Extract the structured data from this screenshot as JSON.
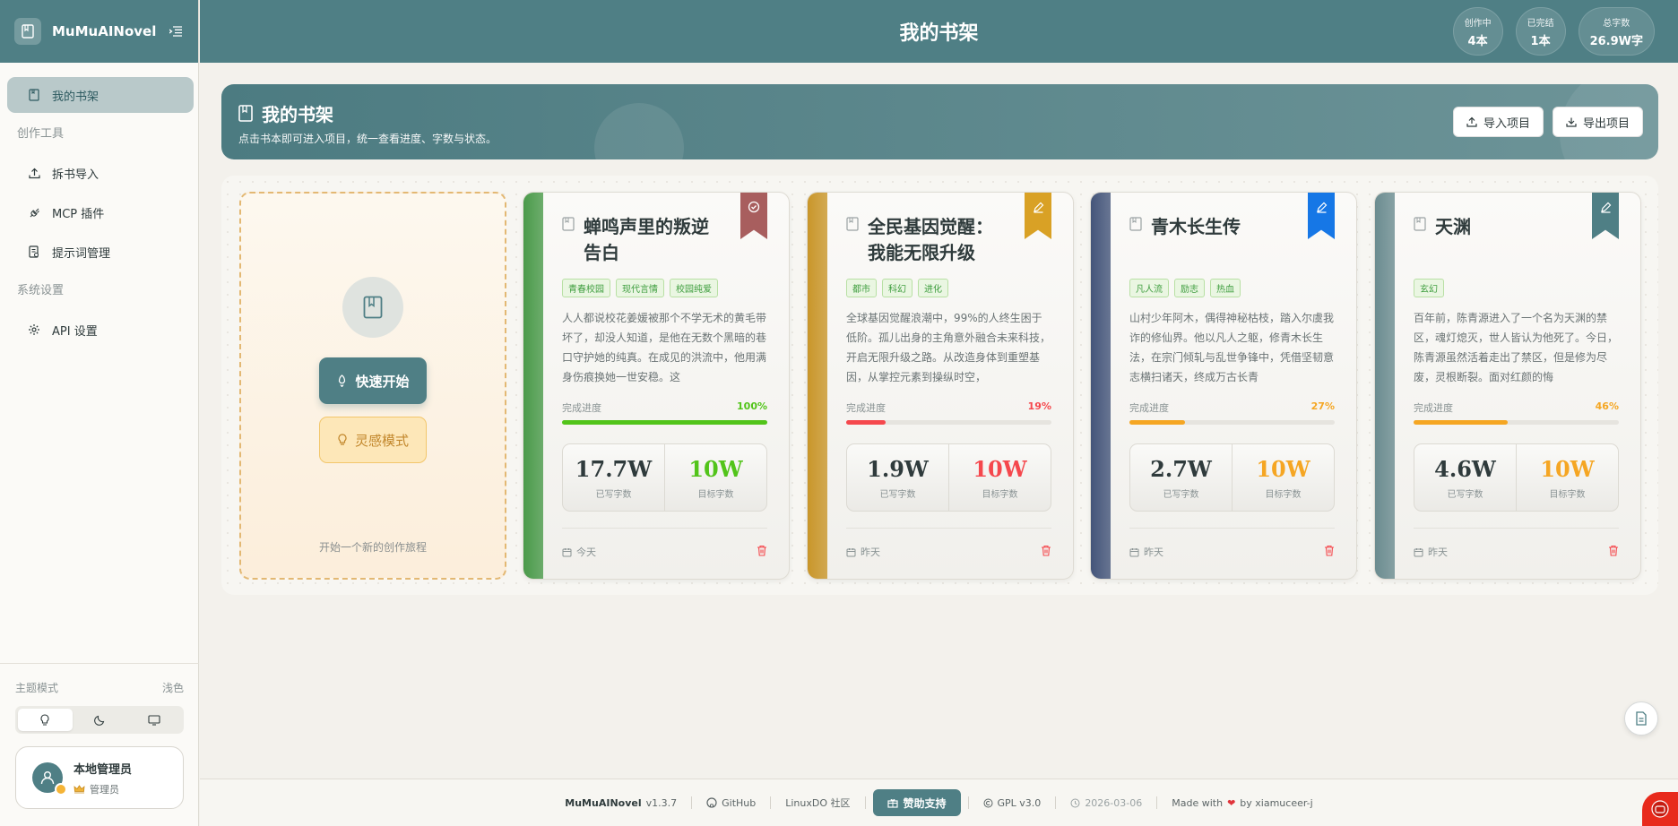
{
  "app": {
    "name": "MuMuAINovel"
  },
  "sidebar": {
    "items": [
      {
        "label": "我的书架",
        "icon": "book-icon"
      },
      {
        "label": "拆书导入",
        "icon": "upload-icon"
      },
      {
        "label": "MCP 插件",
        "icon": "plug-icon"
      },
      {
        "label": "提示词管理",
        "icon": "prompt-doc-icon"
      },
      {
        "label": "API 设置",
        "icon": "gear-icon"
      }
    ],
    "groups": {
      "tools": "创作工具",
      "system": "系统设置"
    },
    "theme": {
      "label": "主题模式",
      "current": "浅色"
    },
    "user": {
      "name": "本地管理员",
      "role": "管理员"
    }
  },
  "header": {
    "title": "我的书架",
    "stats": [
      {
        "label": "创作中",
        "value": "4本"
      },
      {
        "label": "已完结",
        "value": "1本"
      },
      {
        "label": "总字数",
        "value": "26.9W字"
      }
    ]
  },
  "hero": {
    "title": "我的书架",
    "subtitle": "点击书本即可进入项目，统一查看进度、字数与状态。",
    "import_label": "导入项目",
    "export_label": "导出项目"
  },
  "new_card": {
    "quick_label": "快速开始",
    "inspiration_label": "灵感模式",
    "hint": "开始一个新的创作旅程"
  },
  "labels": {
    "progress": "完成进度",
    "written": "已写字数",
    "target": "目标字数"
  },
  "books": [
    {
      "title": "蝉鸣声里的叛逆告白",
      "tags": [
        "青春校园",
        "现代言情",
        "校园纯爱"
      ],
      "description": "人人都说校花姜媛被那个不学无术的黄毛带坏了，却没人知道，是他在无数个黑暗的巷口守护她的纯真。在成见的洪流中，他用满身伤痕换她一世安稳。这",
      "progress_pct": 100,
      "progress_label": "100%",
      "progress_color": "#52c41a",
      "written": "17.7W",
      "target": "10W",
      "target_color": "#52c41a",
      "date": "今天",
      "spine": "#4a9a4a",
      "ribbon": "#a85e5e",
      "ribbon_icon": "check-circle-icon"
    },
    {
      "title": "全民基因觉醒：我能无限升级",
      "tags": [
        "都市",
        "科幻",
        "进化"
      ],
      "description": "全球基因觉醒浪潮中，99%的人终生困于低阶。孤儿出身的主角意外融合未来科技，开启无限升级之路。从改造身体到重塑基因，从掌控元素到操纵时空，",
      "progress_pct": 19,
      "progress_label": "19%",
      "progress_color": "#f5484d",
      "written": "1.9W",
      "target": "10W",
      "target_color": "#f5484d",
      "date": "昨天",
      "spine": "#c9962a",
      "ribbon": "#d9a125",
      "ribbon_icon": "pen-icon"
    },
    {
      "title": "青木长生传",
      "tags": [
        "凡人流",
        "励志",
        "热血"
      ],
      "description": "山村少年阿木，偶得神秘枯枝，踏入尔虞我诈的修仙界。他以凡人之躯，修青木长生法，在宗门倾轧与乱世争锋中，凭借坚韧意志横扫诸天，终成万古长青",
      "progress_pct": 27,
      "progress_label": "27%",
      "progress_color": "#f5a623",
      "written": "2.7W",
      "target": "10W",
      "target_color": "#f5a623",
      "date": "昨天",
      "spine": "#44557a",
      "ribbon": "#1677e6",
      "ribbon_icon": "pen-icon"
    },
    {
      "title": "天渊",
      "tags": [
        "玄幻"
      ],
      "description": "百年前，陈青源进入了一个名为天渊的禁区，魂灯熄灭，世人皆认为他死了。今日，陈青源虽然活着走出了禁区，但是修为尽废，灵根断裂。面对红颜的悔",
      "progress_pct": 46,
      "progress_label": "46%",
      "progress_color": "#f5a623",
      "written": "4.6W",
      "target": "10W",
      "target_color": "#f5a623",
      "date": "昨天",
      "spine": "#6b8c90",
      "ribbon": "#4f7f85",
      "ribbon_icon": "pen-icon"
    }
  ],
  "footer": {
    "name": "MuMuAINovel",
    "version": "v1.3.7",
    "github": "GitHub",
    "community": "LinuxDO 社区",
    "sponsor": "赞助支持",
    "license": "GPL v3.0",
    "date": "2026-03-06",
    "made_with": "Made with",
    "author": "by xiamuceer-j"
  }
}
